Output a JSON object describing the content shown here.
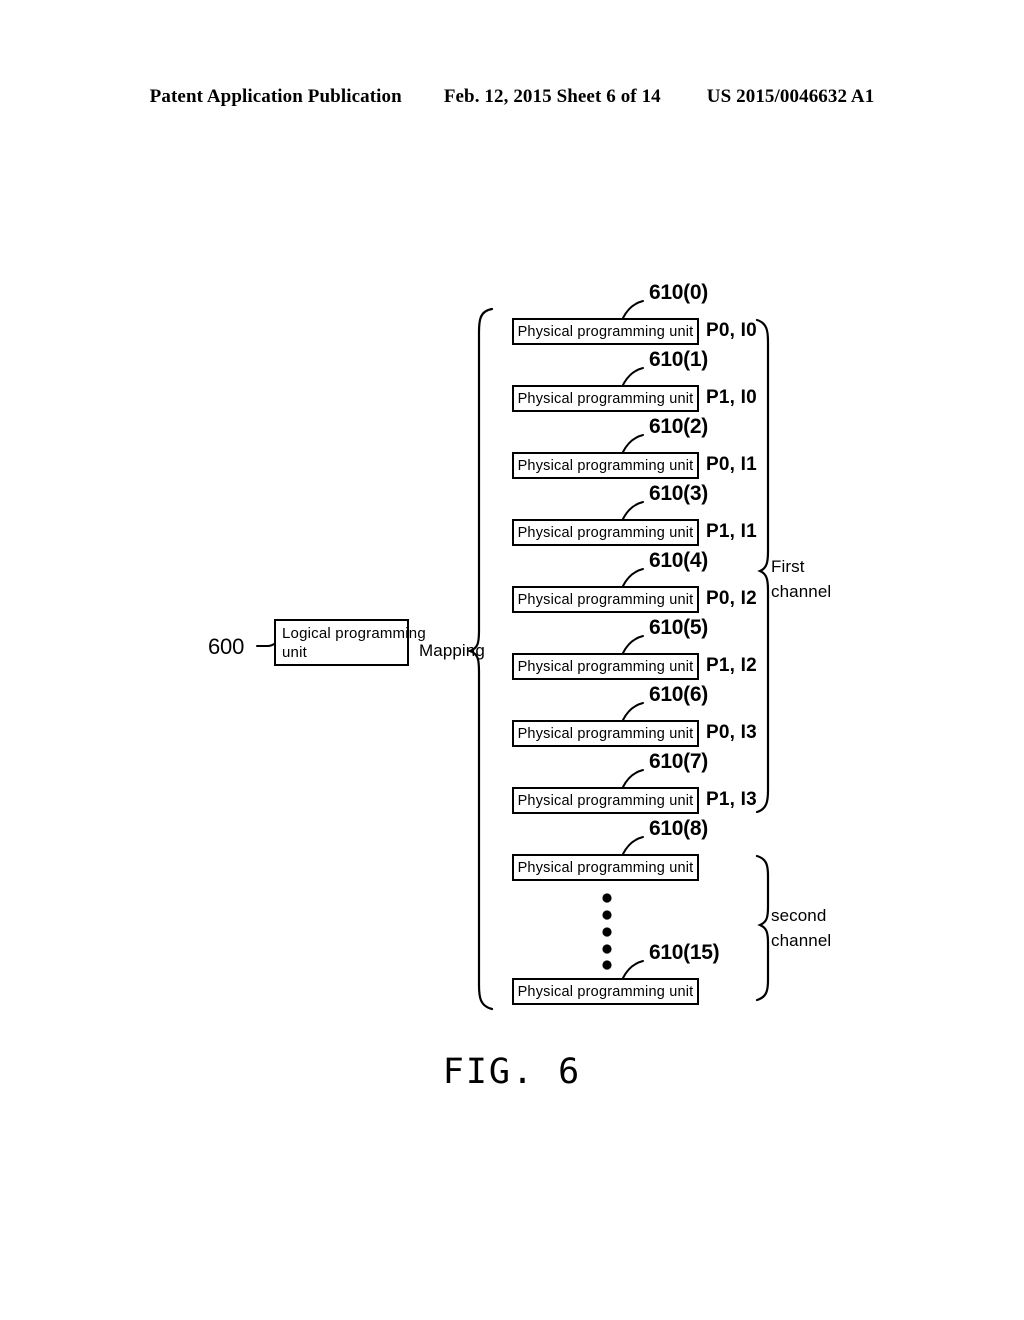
{
  "header": {
    "publication": "Patent Application Publication",
    "date_sheet": "Feb. 12, 2015  Sheet 6 of 14",
    "patent_number": "US 2015/0046632 A1"
  },
  "figure": {
    "caption": "FIG. 6",
    "source_ref": "600",
    "source_label_line1": "Logical  programming",
    "source_label_line2": "unit",
    "mapping_label": "Mapping",
    "unit_label": "Physical  programming  unit",
    "first_channel_line1": "First",
    "first_channel_line2": "channel",
    "second_channel_line1": "second",
    "second_channel_line2": "channel",
    "ellipsis_dots": 5,
    "rows": [
      {
        "ref": "610(0)",
        "unit": "Physical  programming  unit",
        "pi": "P0, I0",
        "channel": "first"
      },
      {
        "ref": "610(1)",
        "unit": "Physical  programming  unit",
        "pi": "P1, I0",
        "channel": "first"
      },
      {
        "ref": "610(2)",
        "unit": "Physical  programming  unit",
        "pi": "P0, I1",
        "channel": "first"
      },
      {
        "ref": "610(3)",
        "unit": "Physical  programming  unit",
        "pi": "P1, I1",
        "channel": "first"
      },
      {
        "ref": "610(4)",
        "unit": "Physical  programming  unit",
        "pi": "P0, I2",
        "channel": "first"
      },
      {
        "ref": "610(5)",
        "unit": "Physical  programming  unit",
        "pi": "P1, I2",
        "channel": "first"
      },
      {
        "ref": "610(6)",
        "unit": "Physical  programming  unit",
        "pi": "P0, I3",
        "channel": "first"
      },
      {
        "ref": "610(7)",
        "unit": "Physical  programming  unit",
        "pi": "P1, I3",
        "channel": "first"
      },
      {
        "ref": "610(8)",
        "unit": "Physical  programming  unit",
        "pi": "",
        "channel": "second"
      },
      {
        "ref": "610(15)",
        "unit": "Physical  programming  unit",
        "pi": "",
        "channel": "second"
      }
    ]
  }
}
